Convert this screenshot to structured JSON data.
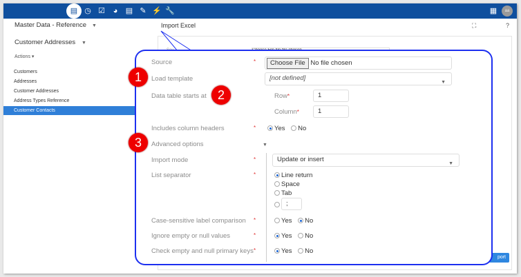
{
  "topbar": {
    "icons": [
      "database-icon",
      "clock-icon",
      "checkbox-icon",
      "gauge-icon",
      "document-list-icon",
      "edit-check-icon",
      "plug-icon",
      "wrench-icon"
    ],
    "right_icons": [
      "grid-icon"
    ],
    "avatar": "aa",
    "color": "#0f4f9e"
  },
  "sidebar": {
    "module": "Master Data - Reference",
    "entity": "Customer Addresses",
    "actions": "Actions",
    "items": [
      {
        "label": "Customers"
      },
      {
        "label": "Addresses"
      },
      {
        "label": "Customer Addresses"
      },
      {
        "label": "Address Types Reference"
      },
      {
        "label": "Customer Contacts",
        "selected": true
      }
    ]
  },
  "dialog": {
    "title": "Import Excel",
    "expand_icon": "expand-icon",
    "help": "?",
    "bg_source_label": "Sou",
    "bg_choose_file": "Choose File",
    "bg_no_file": "No file chosen",
    "import_button": "port"
  },
  "callout": {
    "markers": [
      "1",
      "2",
      "3"
    ],
    "source": {
      "label": "Source",
      "button": "Choose File",
      "value": "No file chosen"
    },
    "load_template": {
      "label": "Load template",
      "value": "[not defined]"
    },
    "data_table": {
      "label": "Data table starts at",
      "row_label": "Row",
      "row_value": "1",
      "column_label": "Column",
      "column_value": "1"
    },
    "headers": {
      "label": "Includes column headers",
      "yes": "Yes",
      "no": "No",
      "selected": "Yes"
    },
    "advanced": {
      "label": "Advanced options"
    },
    "import_mode": {
      "label": "Import mode",
      "value": "Update or insert"
    },
    "list_separator": {
      "label": "List separator",
      "options": [
        "Line return",
        "Space",
        "Tab"
      ],
      "selected": "Line return",
      "custom_value": ";"
    },
    "case_sensitive": {
      "label": "Case-sensitive label comparison",
      "yes": "Yes",
      "no": "No",
      "selected": "No"
    },
    "ignore_empty": {
      "label": "Ignore empty or null values",
      "yes": "Yes",
      "no": "No",
      "selected": "Yes"
    },
    "check_keys": {
      "label": "Check empty and null primary keys",
      "yes": "Yes",
      "no": "No",
      "selected": "Yes"
    },
    "required_mark": "*",
    "border_color": "#1c2ff0"
  }
}
